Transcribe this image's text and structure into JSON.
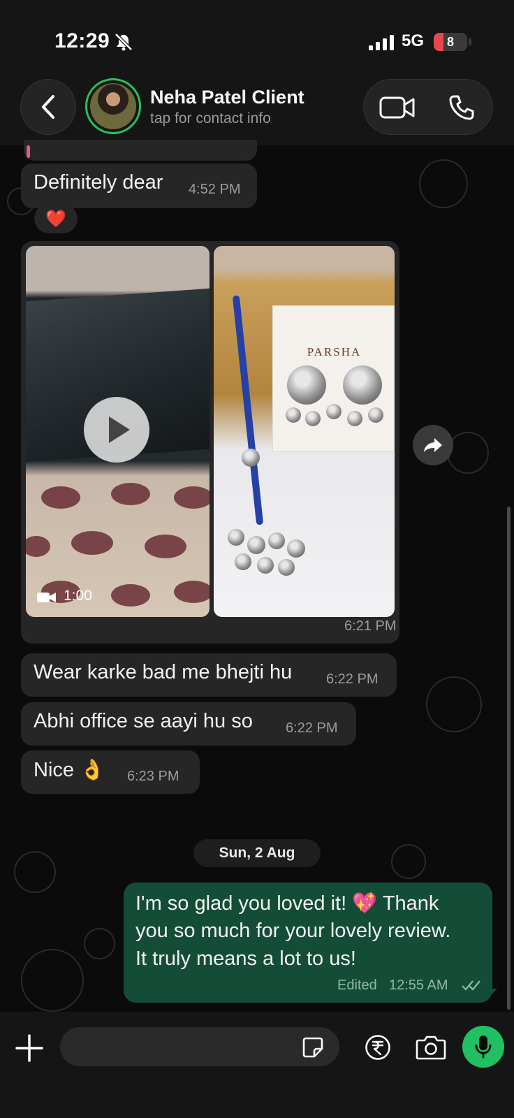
{
  "status_bar": {
    "time": "12:29",
    "network": "5G",
    "battery": "8"
  },
  "header": {
    "contact_name": "Neha Patel Client",
    "contact_subtitle": "tap for contact info"
  },
  "messages": [
    {
      "direction": "incoming",
      "text": "Definitely dear",
      "time": "4:52 PM",
      "reaction": "❤️"
    },
    {
      "direction": "incoming",
      "type": "media",
      "video_duration": "1:00",
      "photo_brand_text": "PARSHA",
      "time": "6:21 PM"
    },
    {
      "direction": "incoming",
      "text": "Wear karke bad me bhejti hu",
      "time": "6:22 PM"
    },
    {
      "direction": "incoming",
      "text": "Abhi office se aayi hu so",
      "time": "6:22 PM"
    },
    {
      "direction": "incoming",
      "text": "Nice 👌",
      "time": "6:23 PM"
    },
    {
      "direction": "outgoing",
      "lines": [
        "I'm so glad you loved it! 💖 Thank",
        "you so much for your lovely review.",
        "It truly means a lot to us!"
      ],
      "status": "Edited",
      "time": "12:55 AM",
      "ticks": "read-double-check"
    }
  ],
  "date_separator": "Sun, 2 Aug",
  "input": {
    "placeholder": ""
  },
  "colors": {
    "accent_green": "#21c063",
    "outgoing_bubble": "#144d37",
    "incoming_bubble": "#262626"
  },
  "icons": [
    "back-chevron-icon",
    "video-camera-icon",
    "phone-icon",
    "bell-off-icon",
    "signal-icon",
    "play-icon",
    "video-camera-small-icon",
    "forward-icon",
    "plus-icon",
    "sticker-icon",
    "rupee-icon",
    "camera-icon",
    "microphone-icon"
  ]
}
